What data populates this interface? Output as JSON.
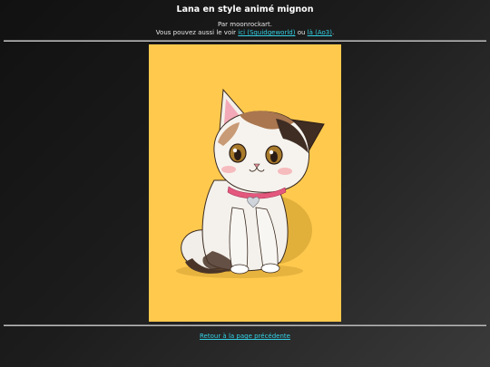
{
  "page": {
    "title": "Lana en style animé mignon"
  },
  "credits": {
    "line1": "Par moonrockart.",
    "line2_prefix": "Vous pouvez aussi le voir ",
    "link1_label": "ici (Squidgeworld)",
    "line2_middle": " ou ",
    "link2_label": "là (Ao3)",
    "line2_suffix": "."
  },
  "artwork": {
    "subject": "cat-illustration",
    "background_color": "#ffc94d"
  },
  "footer": {
    "back_label": "Retour à la page précédente"
  },
  "colors": {
    "link": "#33d2e6",
    "title": "#ffffff"
  }
}
